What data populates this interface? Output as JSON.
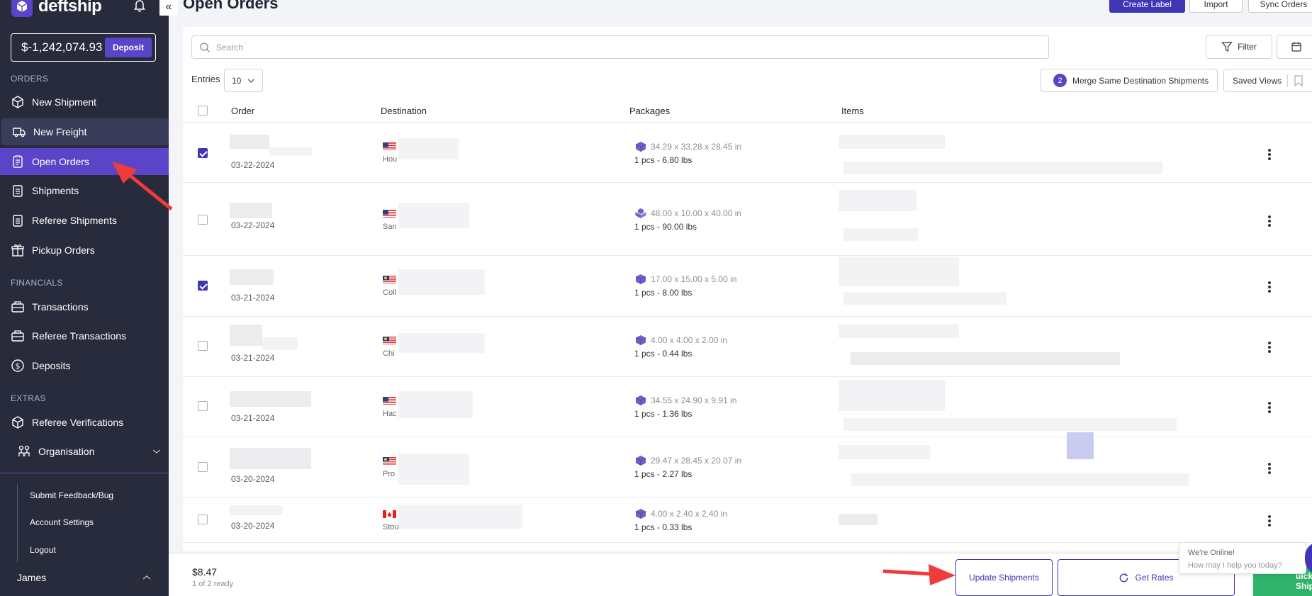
{
  "brand": {
    "name": "deftship"
  },
  "account": {
    "balance": "$-1,242,074.93",
    "deposit_label": "Deposit"
  },
  "sidebar": {
    "sections": {
      "orders": "ORDERS",
      "financials": "FINANCIALS",
      "extras": "EXTRAS"
    },
    "items": [
      {
        "label": "New Shipment"
      },
      {
        "label": "New Freight"
      },
      {
        "label": "Open Orders"
      },
      {
        "label": "Shipments"
      },
      {
        "label": "Referee Shipments"
      },
      {
        "label": "Pickup Orders"
      },
      {
        "label": "Transactions"
      },
      {
        "label": "Referee Transactions"
      },
      {
        "label": "Deposits"
      },
      {
        "label": "Referee Verifications"
      },
      {
        "label": "Organisation"
      }
    ],
    "sub_items": [
      "Submit Feedback/Bug",
      "Account Settings",
      "Logout"
    ],
    "user": "James"
  },
  "header": {
    "title": "Open Orders",
    "create_label": "Create Label",
    "import": "Import",
    "sync_orders": "Sync Orders"
  },
  "toolbar": {
    "search_placeholder": "Search",
    "filter": "Filter",
    "entries_label": "Entries",
    "entries_value": "10",
    "merge_count": "2",
    "merge_label": "Merge Same Destination Shipments",
    "saved_views": "Saved Views"
  },
  "table": {
    "headers": [
      "Order",
      "Destination",
      "Packages",
      "Items"
    ],
    "rows": [
      {
        "checked": true,
        "date": "03-22-2024",
        "city": "Hou",
        "flag": "us",
        "dims": "34.29 x 33.28 x 28.45 in",
        "weight": "1 pcs - 6.80 lbs"
      },
      {
        "checked": false,
        "date": "03-22-2024",
        "city": "San",
        "flag": "us",
        "dims": "48.00 x 10.00 x 40.00 in",
        "weight": "1 pcs - 90.00 lbs"
      },
      {
        "checked": true,
        "date": "03-21-2024",
        "city": "Coll",
        "flag": "my",
        "dims": "17.00 x 15.00 x 5.00 in",
        "weight": "1 pcs - 8.00 lbs"
      },
      {
        "checked": false,
        "date": "03-21-2024",
        "city": "Chi",
        "flag": "my",
        "dims": "4.00 x 4.00 x 2.00 in",
        "weight": "1 pcs - 0.44 lbs"
      },
      {
        "checked": false,
        "date": "03-21-2024",
        "city": "Hac",
        "flag": "us",
        "dims": "34.55 x 24.90 x 9.91 in",
        "weight": "1 pcs - 1.36 lbs"
      },
      {
        "checked": false,
        "date": "03-20-2024",
        "city": "Pro",
        "flag": "my",
        "dims": "29.47 x 28.45 x 20.07 in",
        "weight": "1 pcs - 2.27 lbs"
      },
      {
        "checked": false,
        "date": "03-20-2024",
        "city": "Stou",
        "flag": "ca",
        "dims": "4.00 x 2.40 x 2.40 in",
        "weight": "1 pcs - 0.33 lbs"
      }
    ]
  },
  "footer": {
    "total": "$8.47",
    "ready": "1 of 2 ready",
    "update_shipments": "Update Shipments",
    "get_rates": "Get Rates",
    "quick_ship_line1": "uick",
    "quick_ship_line2": "Ship"
  },
  "chat": {
    "line1": "We're Online!",
    "line2": "How may I help you today?"
  },
  "colors": {
    "sidebar": "#272b3c",
    "accent": "#5a44c7",
    "primary_button": "#3f35b5",
    "annotation_arrow": "#ee3b3b"
  }
}
